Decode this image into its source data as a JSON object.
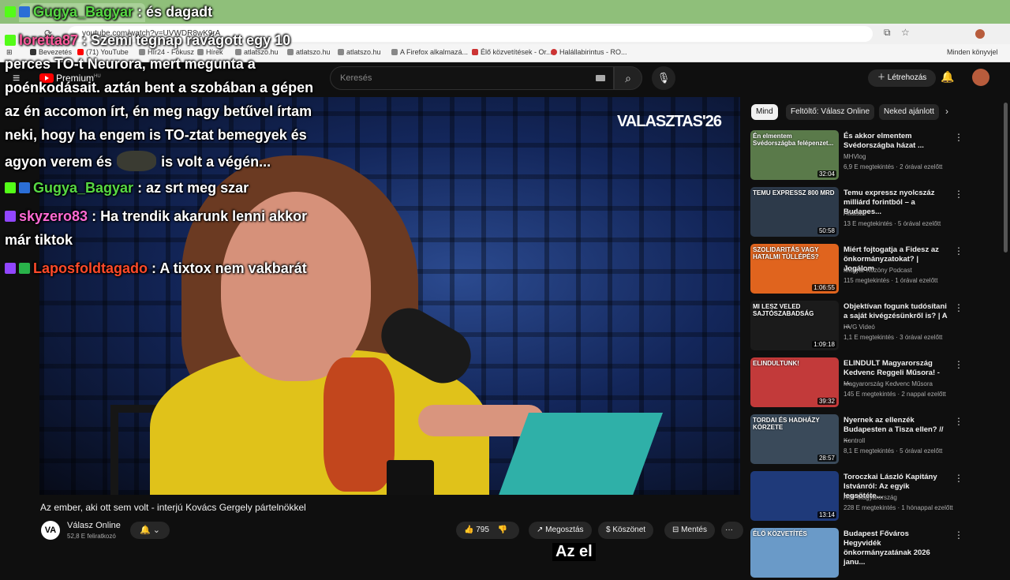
{
  "browser": {
    "tab_title": "",
    "url": "youtube.com/watch?v=UVWDR8wK9rA",
    "bookmarks": [
      "Bevezetés",
      "(71) YouTube",
      "Hír24 - Fókusz",
      "Hírek",
      "atlatszo.hu",
      "atlatszo.hu",
      "atlatszo.hu",
      "A Firefox alkalmazá...",
      "Élő közvetítések - Or...",
      "Halállabirintus - RO..."
    ],
    "other_bookmarks": "Minden könyvjel"
  },
  "yt": {
    "logo": "Premium",
    "logo_sup": "HU",
    "search_placeholder": "Keresés",
    "create": "Létrehozás"
  },
  "chat": [
    {
      "user": "Gugya_Bagyar",
      "user_color": "#57d944",
      "text": " : és dagadt"
    },
    {
      "user": "loretta87",
      "user_color": "#ff5a9c",
      "text": " : Szemi tegnap ravágott egy 10"
    },
    {
      "line": "perces TO-t Neurora, mert megunta a"
    },
    {
      "line": "poénkodásait. aztán bent a szobában a gépen"
    },
    {
      "line": "az én accomon írt, én meg nagy betűvel írtam"
    },
    {
      "line": "neki, hogy ha engem is TO-ztat bemegyek és"
    },
    {
      "line_pre": "agyon verem és",
      "line_post": "is volt a végén..."
    },
    {
      "user": "Gugya_Bagyar",
      "user_color": "#57d944",
      "text": " : az srt meg szar"
    },
    {
      "user": "skyzero83",
      "user_color": "#ff6ad5",
      "text": " : Ha trendik akarunk lenni akkor"
    },
    {
      "line": "már tiktok"
    },
    {
      "user": "Laposfoldtagado",
      "user_color": "#ff4a2a",
      "text": " : A tixtox nem vakbarát"
    }
  ],
  "video": {
    "brand": "VALASZTAS'26",
    "title": "Az ember, aki ott sem volt - interjú Kovács Gergely pártelnökkel",
    "channel": "Válasz Online",
    "channel_logo": "VA",
    "subscribers": "52,8 E feliratkozó",
    "likes": "795",
    "share": "Megosztás",
    "thanks": "Köszönet",
    "save": "Mentés",
    "more": "···",
    "subtitle": "Az el"
  },
  "chips": [
    "Mind",
    "Feltöltő: Válasz Online",
    "Neked ajánlott"
  ],
  "recs": [
    {
      "title": "És akkor elmentem Svédországba házat ...",
      "channel": "MHVlog",
      "meta": "6,9 E megtekintés · 2 órával ezelőtt",
      "dur": "32:04",
      "thumb_text": "Én elmentem Svédországba felépenzet...",
      "color": "#5a7a4a"
    },
    {
      "title": "Temu expressz nyolcszáz milliárd forintból – a Budapes...",
      "channel": "Atlatszo",
      "meta": "13 E megtekintés · 5 órával ezelőtt",
      "dur": "50:58",
      "thumb_text": "TEMU EXPRESSZ 800 MRD",
      "color": "#2d3a4a"
    },
    {
      "title": "Miért fojtogatja a Fidesz az önkormányzatokat? | Jogálom",
      "channel": "Magyar Közöny Podcast",
      "meta": "115 megtekintés · 1 órával ezelőtt",
      "dur": "1:06:55",
      "thumb_text": "SZOLIDARITÁS VAGY HATALMI TÚLLÉPÉS?",
      "color": "#e0641e"
    },
    {
      "title": "Objektívan fogunk tudósítani a saját kivégzésünkről is? | A ...",
      "channel": "HVG Videó",
      "meta": "1,1 E megtekintés · 3 órával ezelőtt",
      "dur": "1:09:18",
      "thumb_text": "MI LESZ VELED SAJTÓSZABADSÁG",
      "color": "#1b1b1b"
    },
    {
      "title": "ELINDULT Magyarország Kedvenc Reggeli Műsora! - ...",
      "channel": "Magyarország Kedvenc Műsora",
      "meta": "145 E megtekintés · 2 nappal ezelőtt",
      "dur": "39:32",
      "thumb_text": "ELINDULTUNK!",
      "color": "#c23a3a"
    },
    {
      "title": "Nyernek az ellenzék Budapesten a Tisza ellen? // ...",
      "channel": "Kontroll",
      "meta": "8,1 E megtekintés · 5 órával ezelőtt",
      "dur": "28:57",
      "thumb_text": "TORDAI ÉS HADHÁZY KÖRZETE",
      "color": "#3a4a5a"
    },
    {
      "title": "Toroczkai László Kapitány Istvánról: Az egyik legsötéte...",
      "channel": "ATV Magyarország",
      "meta": "228 E megtekintés · 1 hónappal ezelőtt",
      "dur": "13:14",
      "thumb_text": "",
      "color": "#1f3a7a"
    },
    {
      "title": "Budapest Főváros Hegyvidék önkormányzatának 2026 janu...",
      "channel": "",
      "meta": "",
      "dur": "",
      "thumb_text": "ÉLŐ KÖZVETÍTÉS",
      "color": "#6a9ac8"
    }
  ]
}
